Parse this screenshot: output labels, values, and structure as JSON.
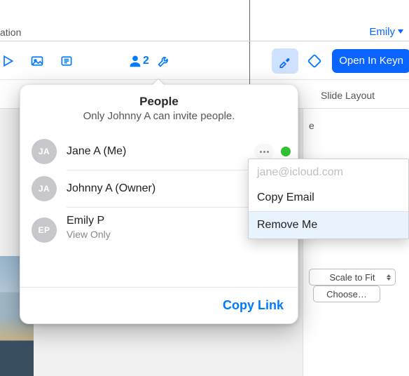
{
  "topbar": {
    "doc_name_fragment": "ation",
    "user_name": "Emily"
  },
  "toolbar": {
    "collab_count": "2",
    "open_button_label": "Open In Keyn",
    "icons": {
      "play": "play-icon",
      "image": "image-icon",
      "text": "text-icon",
      "collab": "collaborator-icon",
      "wrench": "wrench-icon",
      "format": "format-paintbrush-icon",
      "document": "document-outline-icon"
    }
  },
  "subhead": {
    "label": "Slide Layout"
  },
  "side_panel": {
    "fragment_e": "e",
    "scale_label": "Scale to Fit",
    "choose_label": "Choose…"
  },
  "people_popover": {
    "title": "People",
    "subtitle": "Only Johnny A can invite people.",
    "people": [
      {
        "initials": "JA",
        "name": "Jane A (Me)",
        "role": "",
        "status": "green",
        "has_more": true
      },
      {
        "initials": "JA",
        "name": "Johnny A (Owner)",
        "role": "",
        "status": "",
        "has_more": false
      },
      {
        "initials": "EP",
        "name": "Emily P",
        "role": "View Only",
        "status": "yellow",
        "has_more": false
      }
    ],
    "copy_link_label": "Copy Link"
  },
  "submenu": {
    "email": "jane@icloud.com",
    "copy_email_label": "Copy Email",
    "remove_me_label": "Remove Me"
  }
}
